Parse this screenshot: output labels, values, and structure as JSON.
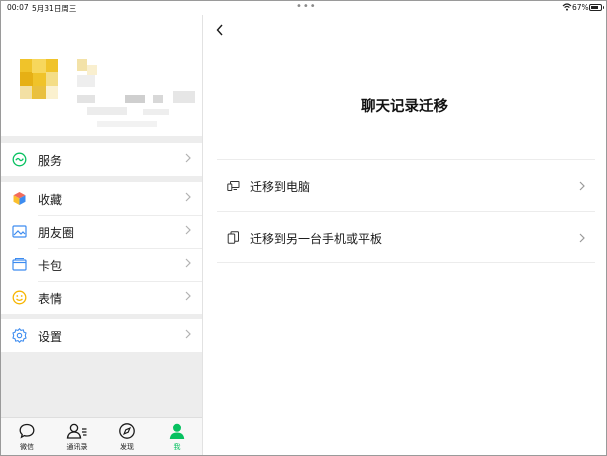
{
  "status_bar": {
    "time": "00:07",
    "date": "5月31日周三",
    "battery": "67%"
  },
  "sidebar": {
    "menu": [
      {
        "label": "服务",
        "icon": "service-icon"
      },
      {
        "label": "收藏",
        "icon": "favorites-icon"
      },
      {
        "label": "朋友圈",
        "icon": "moments-icon"
      },
      {
        "label": "卡包",
        "icon": "card-wallet-icon"
      },
      {
        "label": "表情",
        "icon": "sticker-icon"
      },
      {
        "label": "设置",
        "icon": "settings-icon"
      }
    ],
    "tabs": [
      {
        "label": "微信",
        "icon": "chat-bubble-icon"
      },
      {
        "label": "通讯录",
        "icon": "contacts-icon"
      },
      {
        "label": "发现",
        "icon": "compass-icon"
      },
      {
        "label": "我",
        "icon": "person-icon"
      }
    ],
    "active_tab": "我"
  },
  "main": {
    "title": "聊天记录迁移",
    "options": [
      {
        "label": "迁移到电脑",
        "icon": "computer-icon"
      },
      {
        "label": "迁移到另一台手机或平板",
        "icon": "copy-devices-icon"
      }
    ]
  },
  "colors": {
    "accent": "#07c160",
    "panel_bg": "#ededed"
  }
}
